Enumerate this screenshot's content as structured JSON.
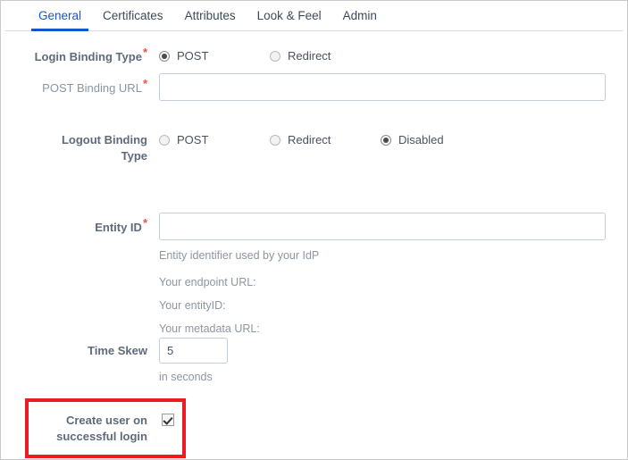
{
  "tabs": [
    {
      "label": "General",
      "active": true
    },
    {
      "label": "Certificates",
      "active": false
    },
    {
      "label": "Attributes",
      "active": false
    },
    {
      "label": "Look & Feel",
      "active": false
    },
    {
      "label": "Admin",
      "active": false
    }
  ],
  "form": {
    "login_binding": {
      "label": "Login Binding Type",
      "required_mark": "*",
      "options": [
        {
          "label": "POST",
          "selected": true
        },
        {
          "label": "Redirect",
          "selected": false
        }
      ]
    },
    "post_binding_url": {
      "label": "POST Binding URL",
      "required_mark": "*",
      "value": "",
      "placeholder": ""
    },
    "logout_binding": {
      "label_line1": "Logout Binding",
      "label_line2": "Type",
      "options": [
        {
          "label": "POST",
          "selected": false
        },
        {
          "label": "Redirect",
          "selected": false
        },
        {
          "label": "Disabled",
          "selected": true
        }
      ]
    },
    "entity_id": {
      "label": "Entity ID",
      "required_mark": "*",
      "value": "",
      "placeholder": "",
      "help": "Entity identifier used by your IdP",
      "endpoint_url": "Your endpoint URL:",
      "entity_id_line": "Your entityID:",
      "metadata_url": "Your metadata URL:"
    },
    "time_skew": {
      "label": "Time Skew",
      "value": "5",
      "help": "in seconds"
    },
    "create_user": {
      "label_line1": "Create user on",
      "label_line2": "successful login",
      "checked": true
    }
  },
  "annotation": {
    "color": "#ed1c24"
  }
}
